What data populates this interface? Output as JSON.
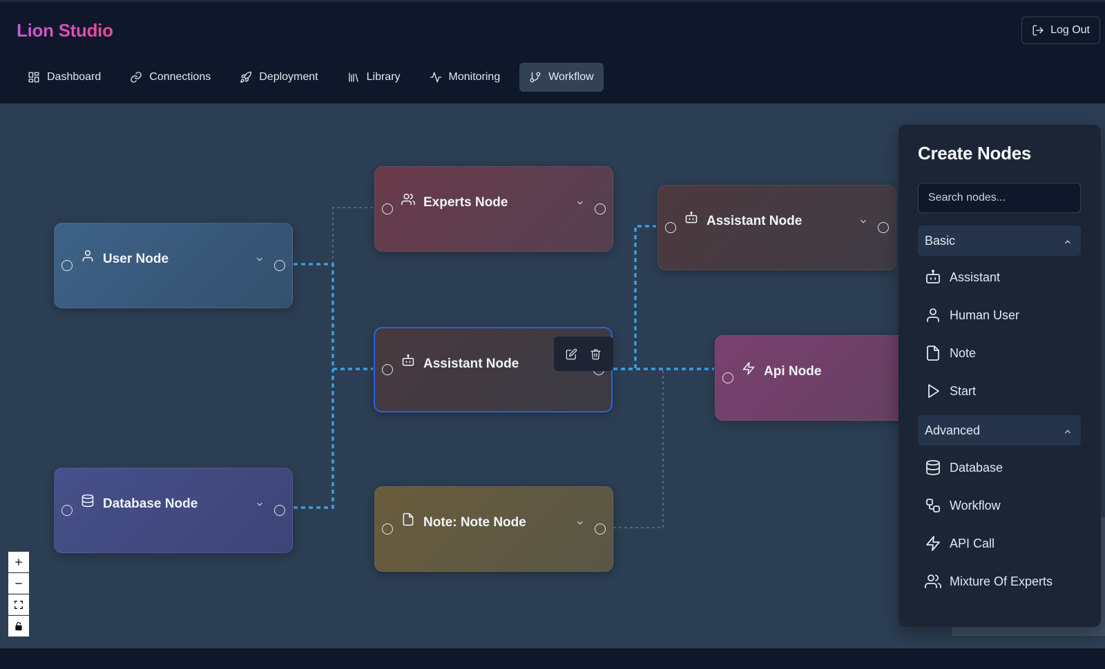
{
  "app": {
    "title": "Lion Studio",
    "logout_label": "Log Out"
  },
  "nav": {
    "items": [
      {
        "label": "Dashboard",
        "icon": "dashboard-icon"
      },
      {
        "label": "Connections",
        "icon": "link-icon"
      },
      {
        "label": "Deployment",
        "icon": "rocket-icon"
      },
      {
        "label": "Library",
        "icon": "library-icon"
      },
      {
        "label": "Monitoring",
        "icon": "activity-icon"
      },
      {
        "label": "Workflow",
        "icon": "git-branch-icon",
        "active": true
      }
    ]
  },
  "nodes": {
    "user": {
      "title": "User Node",
      "icon": "user-icon",
      "color": "#3b5a80"
    },
    "experts": {
      "title": "Experts Node",
      "icon": "users-icon",
      "color": "#5a3a4a"
    },
    "assistant_top": {
      "title": "Assistant Node",
      "icon": "bot-icon",
      "color": "#463c42"
    },
    "assistant_mid": {
      "title": "Assistant Node",
      "icon": "bot-icon",
      "color": "#3f3b42",
      "selected": true
    },
    "api": {
      "title": "Api Node",
      "icon": "zap-icon",
      "color": "#6a3f6a"
    },
    "database": {
      "title": "Database Node",
      "icon": "database-icon",
      "color": "#434a82"
    },
    "note": {
      "title": "Note: Note Node",
      "icon": "file-icon",
      "color": "#5c5840"
    }
  },
  "node_toolbar": {
    "edit_icon": "edit-icon",
    "delete_icon": "trash-icon"
  },
  "canvas_controls": [
    "zoom-in-icon",
    "zoom-out-icon",
    "fit-view-icon",
    "lock-icon"
  ],
  "panel": {
    "title": "Create Nodes",
    "search_placeholder": "Search nodes...",
    "sections": [
      {
        "label": "Basic",
        "items": [
          {
            "label": "Assistant",
            "icon": "bot-icon"
          },
          {
            "label": "Human User",
            "icon": "user-icon"
          },
          {
            "label": "Note",
            "icon": "file-icon"
          },
          {
            "label": "Start",
            "icon": "play-icon"
          }
        ]
      },
      {
        "label": "Advanced",
        "items": [
          {
            "label": "Database",
            "icon": "database-icon"
          },
          {
            "label": "Workflow",
            "icon": "workflow-icon"
          },
          {
            "label": "API Call",
            "icon": "zap-icon"
          },
          {
            "label": "Mixture Of Experts",
            "icon": "users-icon"
          }
        ]
      }
    ]
  },
  "colors": {
    "accent_edge": "#3b9ee0",
    "canvas": "#2c3e53",
    "selection": "#2563eb"
  }
}
